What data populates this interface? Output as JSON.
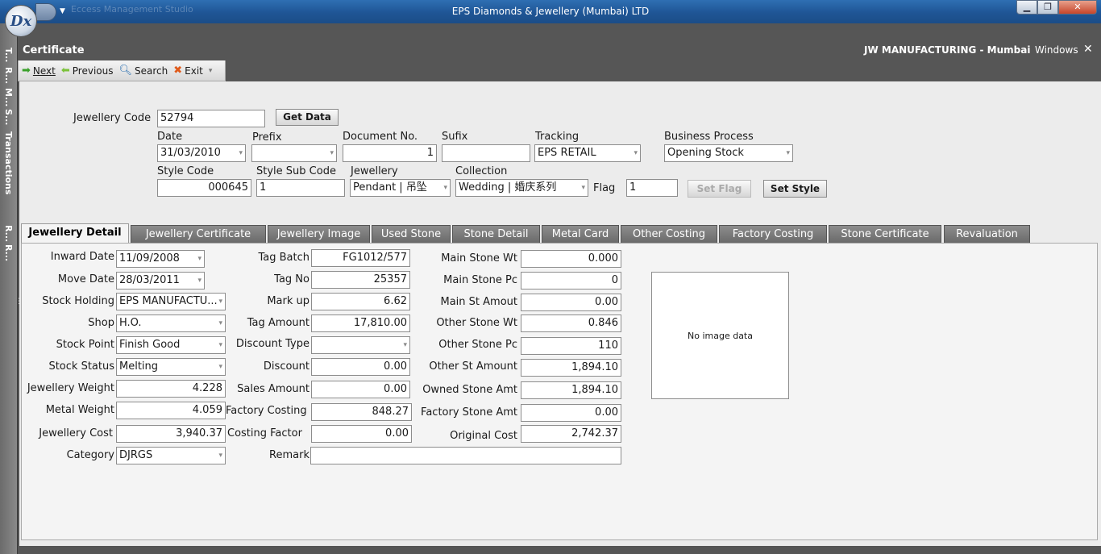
{
  "window": {
    "title": "EPS Diamonds & Jewellery (Mumbai) LTD",
    "app_logo": "Dx",
    "qat_text": "Eccess Management Studio"
  },
  "sidebar": {
    "items": [
      "T...",
      "R...",
      "M...",
      "S...",
      "Transactions",
      "R...",
      "R..."
    ]
  },
  "header": {
    "form_title": "Certificate",
    "org": "JW MANUFACTURING - Mumbai",
    "windows_label": "Windows",
    "close": "✕"
  },
  "toolbar": {
    "next": "Next",
    "previous": "Previous",
    "search": "Search",
    "exit": "Exit"
  },
  "form": {
    "jewellery_code_label": "Jewellery Code",
    "jewellery_code": "52794",
    "get_data": "Get Data",
    "date_label": "Date",
    "date": "31/03/2010",
    "prefix_label": "Prefix",
    "prefix": "",
    "document_no_label": "Document No.",
    "document_no": "1",
    "sufix_label": "Sufix",
    "sufix": "",
    "tracking_label": "Tracking",
    "tracking": "EPS RETAIL",
    "business_process_label": "Business Process",
    "business_process": "Opening Stock",
    "style_code_label": "Style Code",
    "style_code": "000645",
    "style_sub_code_label": "Style Sub Code",
    "style_sub_code": "1",
    "jewellery_label": "Jewellery",
    "jewellery": "Pendant | 吊坠",
    "collection_label": "Collection",
    "collection": "Wedding | 婚庆系列",
    "flag_label": "Flag",
    "flag": "1",
    "set_flag": "Set Flag",
    "set_style": "Set Style"
  },
  "tabs": [
    "Jewellery Detail",
    "Jewellery Certificate",
    "Jewellery Image",
    "Used Stone",
    "Stone Detail",
    "Metal Card",
    "Other Costing",
    "Factory Costing",
    "Stone Certificate",
    "Revaluation"
  ],
  "detail": {
    "col1": [
      {
        "label": "Inward Date",
        "value": "11/09/2008"
      },
      {
        "label": "Move Date",
        "value": "28/03/2011"
      },
      {
        "label": "Stock Holding",
        "value": "EPS MANUFACTU..."
      },
      {
        "label": "Shop",
        "value": "H.O."
      },
      {
        "label": "Stock Point",
        "value": "Finish Good"
      },
      {
        "label": "Stock Status",
        "value": "Melting"
      },
      {
        "label": "Jewellery Weight",
        "value": "4.228"
      },
      {
        "label": "Metal Weight",
        "value": "4.059"
      },
      {
        "label": "Jewellery Cost",
        "value": "3,940.37"
      },
      {
        "label": "Category",
        "value": "DJRGS"
      }
    ],
    "col2": [
      {
        "label": "Tag Batch",
        "value": "FG1012/577"
      },
      {
        "label": "Tag No",
        "value": "25357"
      },
      {
        "label": "Mark up",
        "value": "6.62"
      },
      {
        "label": "Tag Amount",
        "value": "17,810.00"
      },
      {
        "label": "Discount Type",
        "value": ""
      },
      {
        "label": "Discount",
        "value": "0.00"
      },
      {
        "label": "Sales Amount",
        "value": "0.00"
      },
      {
        "label": "Factory Costing",
        "value": "848.27"
      },
      {
        "label": "Costing  Factor",
        "value": "0.00"
      },
      {
        "label": "Remark",
        "value": ""
      }
    ],
    "col3": [
      {
        "label": "Main Stone Wt",
        "value": "0.000"
      },
      {
        "label": "Main Stone Pc",
        "value": "0"
      },
      {
        "label": "Main St Amout",
        "value": "0.00"
      },
      {
        "label": "Other Stone Wt",
        "value": "0.846"
      },
      {
        "label": "Other Stone Pc",
        "value": "110"
      },
      {
        "label": "Other St Amount",
        "value": "1,894.10"
      },
      {
        "label": "Owned Stone Amt",
        "value": "1,894.10"
      },
      {
        "label": "Factory Stone Amt",
        "value": "0.00"
      },
      {
        "label": "Original Cost",
        "value": "2,742.37"
      }
    ],
    "image_placeholder": "No image data"
  }
}
